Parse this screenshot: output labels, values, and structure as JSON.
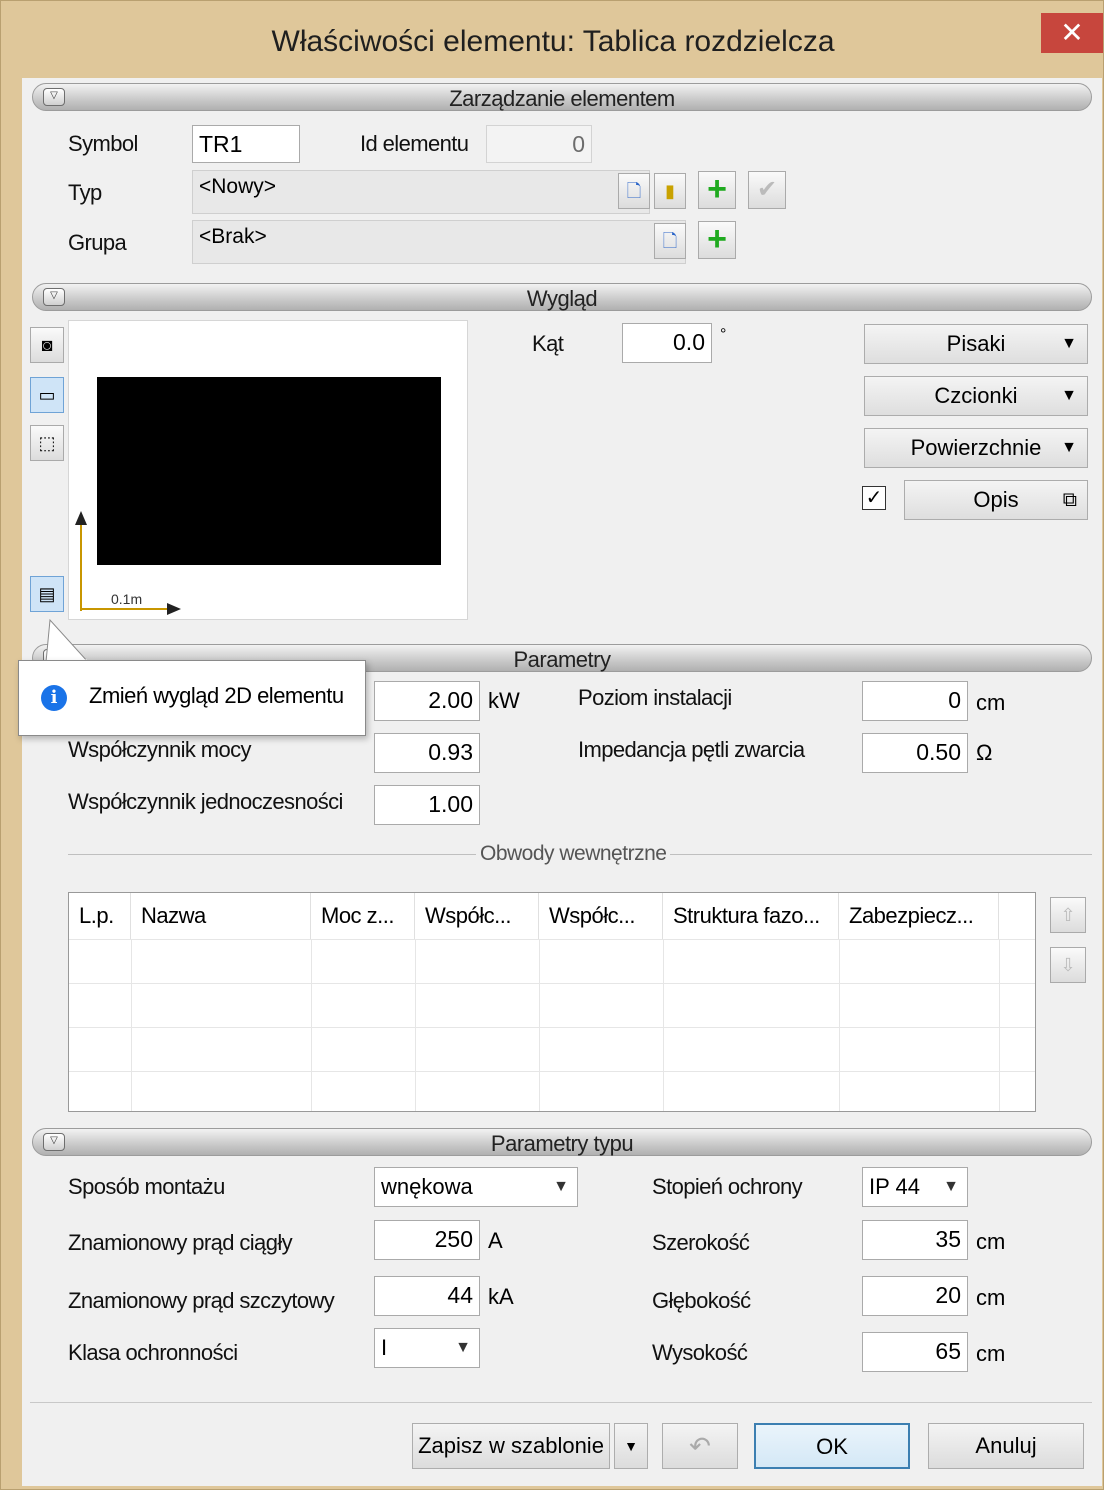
{
  "window": {
    "title": "Właściwości elementu: Tablica rozdzielcza",
    "close_label": "✕"
  },
  "colors": {
    "frame": "#dfc79a",
    "close": "#c7463d",
    "accent_green": "#1faa1f",
    "info_blue": "#1a73e8"
  },
  "sections": {
    "management": "Zarządzanie elementem",
    "appearance": "Wygląd",
    "parameters": "Parametry",
    "type_parameters": "Parametry typu"
  },
  "management": {
    "symbol_label": "Symbol",
    "symbol_value": "TR1",
    "id_label": "Id elementu",
    "id_value": "0",
    "type_label": "Typ",
    "type_value": "<Nowy>",
    "group_label": "Grupa",
    "group_value": "<Brak>"
  },
  "appearance": {
    "angle_label": "Kąt",
    "angle_value": "0.0",
    "angle_unit": "°",
    "scale_label": "0.1m",
    "pens_label": "Pisaki",
    "fonts_label": "Czcionki",
    "surfaces_label": "Powierzchnie",
    "description_label": "Opis",
    "description_checked": true
  },
  "tooltip": {
    "text": "Zmień wygląd 2D elementu",
    "icon": "info-icon"
  },
  "parameters": {
    "power_value": "2.00",
    "power_unit": "kW",
    "power_factor_label": "Współczynnik mocy",
    "power_factor_value": "0.93",
    "simultaneity_label": "Współczynnik jednoczesności",
    "simultaneity_value": "1.00",
    "install_level_label": "Poziom instalacji",
    "install_level_value": "0",
    "install_level_unit": "cm",
    "loop_impedance_label": "Impedancja pętli zwarcia",
    "loop_impedance_value": "0.50",
    "loop_impedance_unit": "Ω",
    "circuits_legend": "Obwody wewnętrzne",
    "columns": [
      "L.p.",
      "Nazwa",
      "Moc z...",
      "Współc...",
      "Współc...",
      "Struktura fazo...",
      "Zabezpiecz..."
    ]
  },
  "type_parameters": {
    "mount_label": "Sposób montażu",
    "mount_value": "wnękowa",
    "rated_current_label": "Znamionowy prąd ciągły",
    "rated_current_value": "250",
    "rated_current_unit": "A",
    "peak_current_label": "Znamionowy prąd szczytowy",
    "peak_current_value": "44",
    "peak_current_unit": "kA",
    "protection_class_label": "Klasa ochronności",
    "protection_class_value": "I",
    "ip_label": "Stopień ochrony",
    "ip_value": "IP 44",
    "width_label": "Szerokość",
    "width_value": "35",
    "width_unit": "cm",
    "depth_label": "Głębokość",
    "depth_value": "20",
    "depth_unit": "cm",
    "height_label": "Wysokość",
    "height_value": "65",
    "height_unit": "cm"
  },
  "footer": {
    "save_template_label": "Zapisz w szablonie",
    "ok_label": "OK",
    "cancel_label": "Anuluj"
  }
}
